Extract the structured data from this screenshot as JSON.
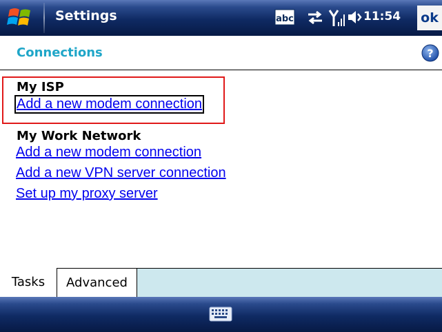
{
  "title_bar": {
    "title": "Settings",
    "time": "11:54",
    "ok_label": "ok",
    "icons": [
      "windows-start-icon",
      "input-method-abc-icon",
      "connectivity-arrows-icon",
      "signal-strength-icon",
      "volume-icon"
    ]
  },
  "header": {
    "title": "Connections",
    "help_icon": "help-icon",
    "title_color": "#1fa6c8"
  },
  "sections": [
    {
      "heading": "My ISP",
      "links": [
        "Add a new modem connection"
      ]
    },
    {
      "heading": "My Work Network",
      "links": [
        "Add a new modem connection",
        "Add a new VPN server connection",
        "Set up my proxy server"
      ]
    }
  ],
  "tabs": [
    {
      "label": "Tasks",
      "active": true
    },
    {
      "label": "Advanced",
      "active": false
    }
  ],
  "bottom_bar": {
    "icon": "keyboard-icon"
  },
  "colors": {
    "link": "#0000ee",
    "highlight_box": "#e01818",
    "tab_strip": "#cde8ee",
    "bar_dark": "#0f2a63"
  }
}
